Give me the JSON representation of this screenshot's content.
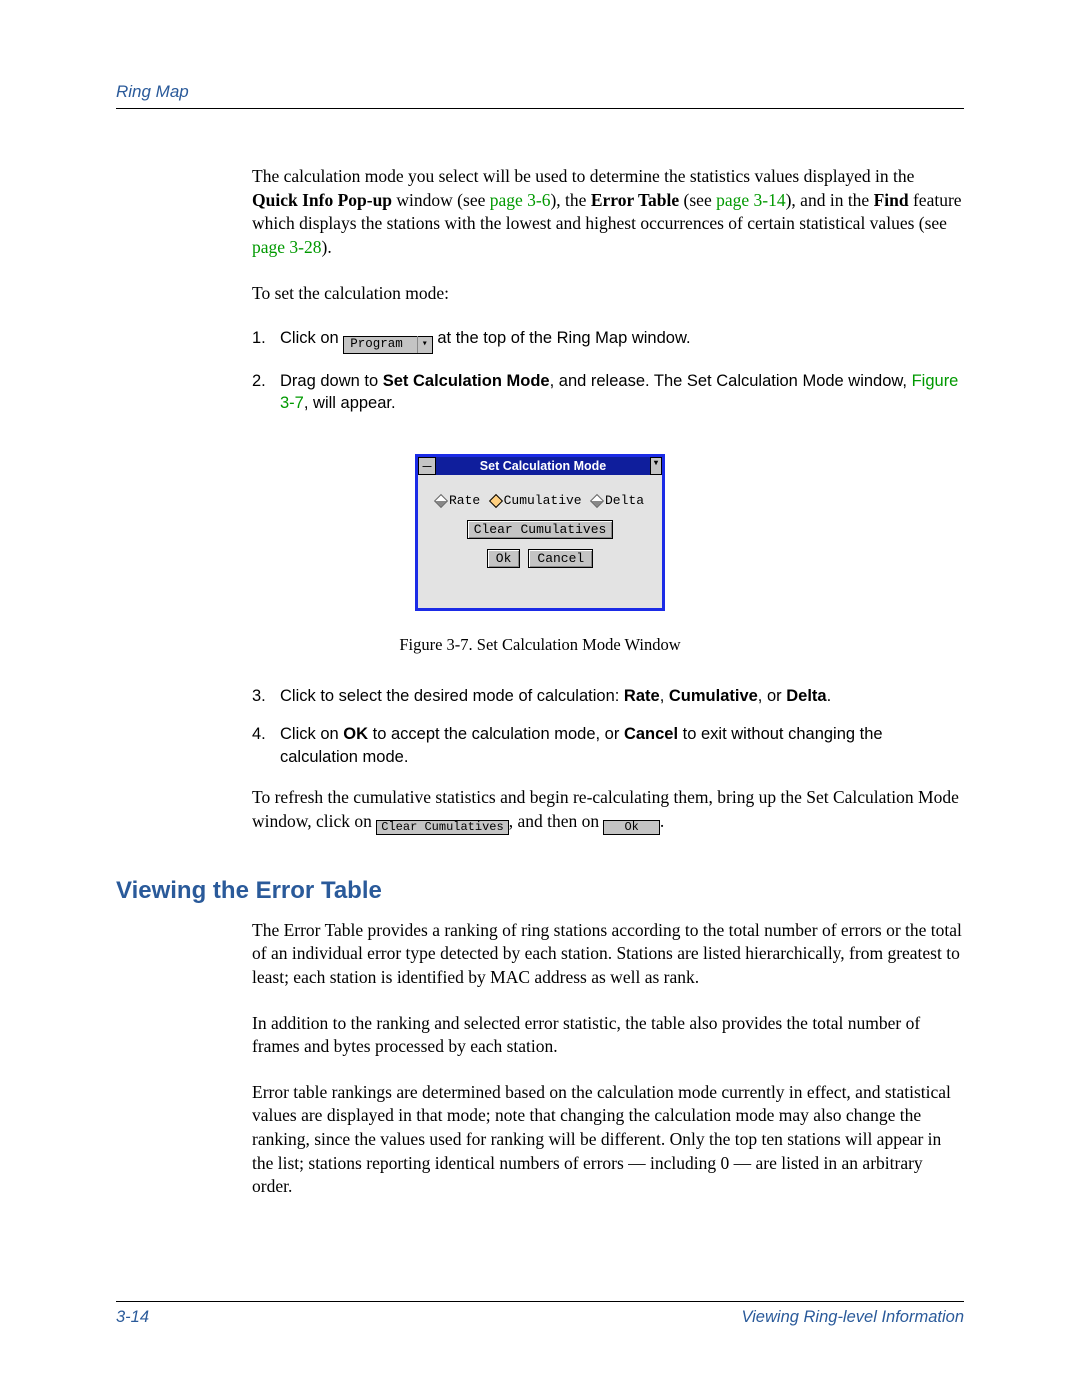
{
  "header": {
    "title": "Ring Map"
  },
  "intro": {
    "part1": "The calculation mode you select will be used to determine the statistics values displayed in the ",
    "bold1": "Quick Info Pop-up",
    "part2": " window (see ",
    "link1": "page 3-6",
    "part3": "), the ",
    "bold2": "Error Table",
    "part4": " (see ",
    "link2": "page 3-14",
    "part5": "), and in the ",
    "bold3": "Find",
    "part6": " feature which displays the stations with the lowest and highest occurrences of certain statistical values (see ",
    "link3": "page 3-28",
    "part7": ")."
  },
  "setmode_intro": "To set the calculation mode:",
  "steps": [
    {
      "num": "1.",
      "pre": "Click on ",
      "btn_label": "Program",
      "post": " at the top of the Ring Map window."
    },
    {
      "num": "2.",
      "pre": "Drag down to ",
      "bold": "Set Calculation Mode",
      "mid": ", and release. The Set Calculation Mode window, ",
      "link": "Figure 3-7",
      "post": ", will appear."
    },
    {
      "num": "3.",
      "pre": "Click to select the desired mode of calculation: ",
      "b1": "Rate",
      "c1": ", ",
      "b2": "Cumulative",
      "c2": ", or ",
      "b3": "Delta",
      "post": "."
    },
    {
      "num": "4.",
      "pre": "Click on ",
      "b1": "OK",
      "mid": " to accept the calculation mode, or ",
      "b2": "Cancel",
      "post": " to exit without changing the calculation mode."
    }
  ],
  "dialog": {
    "title": "Set Calculation Mode",
    "radios": [
      "Rate",
      "Cumulative",
      "Delta"
    ],
    "clear_btn": "Clear Cumulatives",
    "ok_btn": "Ok",
    "cancel_btn": "Cancel"
  },
  "figure_caption": "Figure 3-7. Set Calculation Mode Window",
  "refresh": {
    "part1": "To refresh the cumulative statistics and begin re-calculating them, bring up the Set Calculation Mode window, click on ",
    "btn1": "Clear Cumulatives",
    "part2": ", and then on ",
    "btn2": "Ok",
    "part3": "."
  },
  "section_heading": "Viewing the Error Table",
  "error_paras": [
    "The Error Table provides a ranking of ring stations according to the total number of errors or the total of an individual error type detected by each station. Stations are listed hierarchically, from greatest to least; each station is identified by MAC address as well as rank.",
    "In addition to the ranking and selected error statistic, the table also provides the total number of frames and bytes processed by each station.",
    "Error table rankings are determined based on the calculation mode currently in effect, and statistical values are displayed in that mode; note that changing the calculation mode may also change the ranking, since the values used for ranking will be different. Only the top ten stations will appear in the list; stations reporting identical numbers of errors — including 0 — are listed in an arbitrary order."
  ],
  "footer": {
    "page_num": "3-14",
    "section": "Viewing Ring-level Information"
  }
}
